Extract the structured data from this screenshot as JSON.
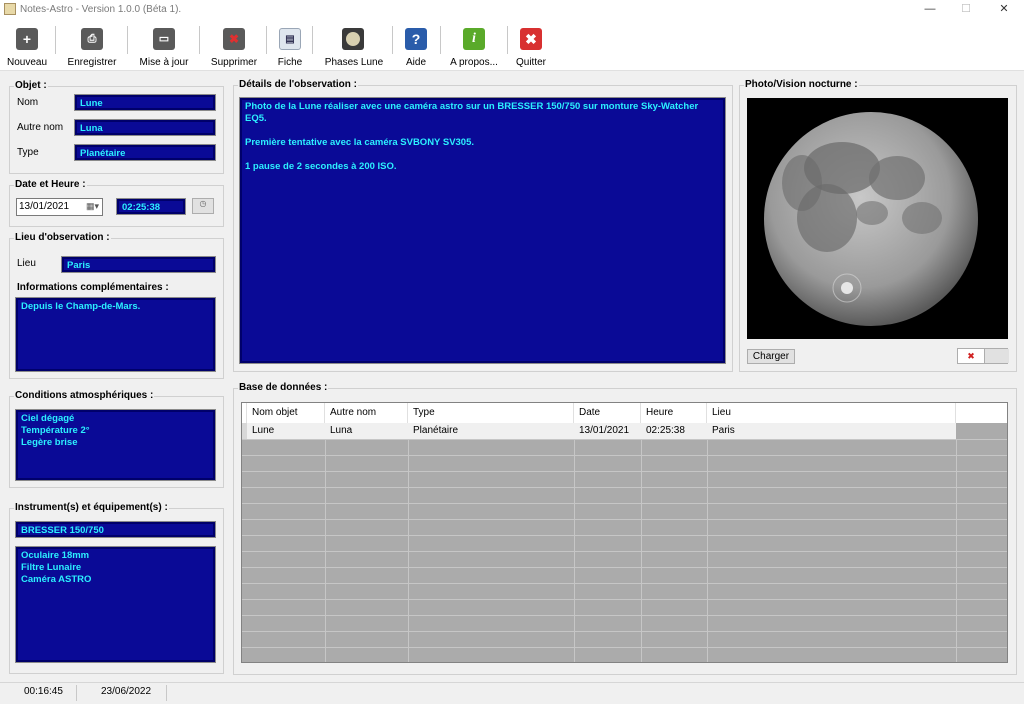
{
  "window": {
    "title": "Notes-Astro - Version 1.0.0 (Béta 1).",
    "minimize": "—",
    "maximize": "☐",
    "close": "✕"
  },
  "toolbar": {
    "nouveau": "Nouveau",
    "enregistrer": "Enregistrer",
    "mise_a_jour": "Mise à jour",
    "supprimer": "Supprimer",
    "fiche": "Fiche",
    "phases_lune": "Phases Lune",
    "aide": "Aide",
    "apropos": "A propos...",
    "quitter": "Quitter"
  },
  "objet": {
    "title": "Objet :",
    "nom_label": "Nom",
    "nom": "Lune",
    "autre_nom_label": "Autre nom",
    "autre_nom": "Luna",
    "type_label": "Type",
    "type": "Planétaire"
  },
  "date_heure": {
    "title": "Date et Heure :",
    "date": "13/01/2021",
    "heure": "02:25:38"
  },
  "lieu": {
    "title": "Lieu d'observation :",
    "label": "Lieu",
    "value": "Paris",
    "infos_title": "Informations complémentaires :",
    "infos": "Depuis le Champ-de-Mars."
  },
  "conditions": {
    "title": "Conditions atmosphériques :",
    "value": "Ciel dégagé\nTempérature 2°\nLegère brise"
  },
  "instruments": {
    "title": "Instrument(s) et équipement(s) :",
    "instrument": "BRESSER 150/750",
    "equipement": "Oculaire 18mm\nFiltre Lunaire\nCaméra ASTRO"
  },
  "details": {
    "title": "Détails de l'observation :",
    "text": "Photo de la Lune réaliser avec une caméra astro sur un BRESSER 150/750 sur monture Sky-Watcher EQ5.\n\nPremière tentative avec la caméra SVBONY SV305.\n\n1 pause de 2 secondes à 200 ISO."
  },
  "photo": {
    "title": "Photo/Vision nocturne :",
    "charger": "Charger",
    "delete": "✖"
  },
  "database": {
    "title": "Base de données :",
    "columns": [
      "Nom objet",
      "Autre nom",
      "Type",
      "Date",
      "Heure",
      "Lieu"
    ],
    "rows": [
      [
        "Lune",
        "Luna",
        "Planétaire",
        "13/01/2021",
        "02:25:38",
        "Paris"
      ]
    ]
  },
  "status": {
    "time": "00:16:45",
    "date": "23/06/2022"
  },
  "colors": {
    "field_bg": "#0a0a96",
    "field_text": "#2cf0ff"
  }
}
